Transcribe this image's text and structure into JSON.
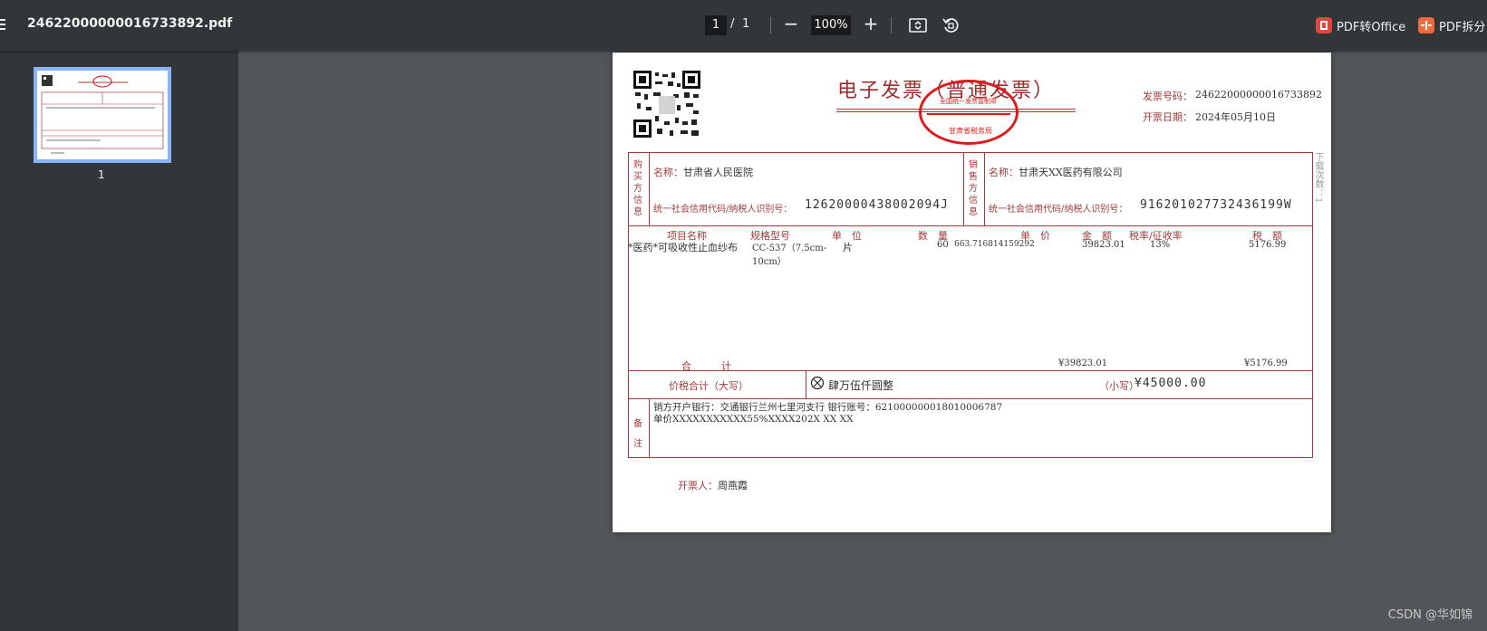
{
  "toolbar": {
    "file_name": "24622000000016733892.pdf",
    "page_current": "1",
    "page_sep": "/",
    "page_total": "1",
    "zoom": "100%",
    "zoom_out": "−",
    "zoom_in": "+",
    "pdf_to_office": "PDF转Office",
    "pdf_split": "PDF拆分"
  },
  "sidebar": {
    "thumb_number": "1"
  },
  "invoice": {
    "title": "电子发票（普通发票）",
    "invoice_no_label": "发票号码：",
    "invoice_no": "24622000000016733892",
    "date_label": "开票日期：",
    "date": "2024年05月10日",
    "seal_text": "全国统一发票监制章",
    "seal_sub": "甘肃省税务局",
    "download_count": "下载次数：1",
    "buyer_vertical": [
      "购",
      "买",
      "方",
      "信",
      "息"
    ],
    "seller_vertical": [
      "销",
      "售",
      "方",
      "信",
      "息"
    ],
    "buyer_name_label": "名称：",
    "buyer_name": "甘肃省人民医院",
    "buyer_tax_label": "统一社会信用代码/纳税人识别号：",
    "buyer_tax": "12620000438002094J",
    "seller_name_label": "名称：",
    "seller_name": "甘肃天XX医药有限公司",
    "seller_tax_label": "统一社会信用代码/纳税人识别号：",
    "seller_tax": "916201027732436199W",
    "headers": [
      "项目名称",
      "规格型号",
      "单　位",
      "数　量",
      "单　价",
      "金　额",
      "税率/征收率",
      "税　额"
    ],
    "item": {
      "name": "*医药*可吸收性止血纱布",
      "spec": "CC-537（7.5cm-",
      "spec2": "10cm）",
      "unit": "片",
      "qty": "60",
      "price": "663.716814159292",
      "amount": "39823.01",
      "rate": "13%",
      "tax": "5176.99"
    },
    "total_label": "合　　　计",
    "total_amount": "¥39823.01",
    "total_tax": "¥5176.99",
    "sum_label": "价税合计（大写）",
    "sum_big": "肆万伍仟圆整",
    "sum_small_label": "（小写）",
    "sum_small": "¥45000.00",
    "remark_vertical": [
      "备",
      "注"
    ],
    "remark_line1": "销方开户银行：交通银行兰州七里河支行 银行账号：621000000018010006787",
    "remark_line2": "单价XXXXXXXXXXX55%XXXX202X XX XX",
    "issuer_label": "开票人：",
    "issuer": "周燕霞"
  },
  "watermark": "CSDN @华如锦"
}
